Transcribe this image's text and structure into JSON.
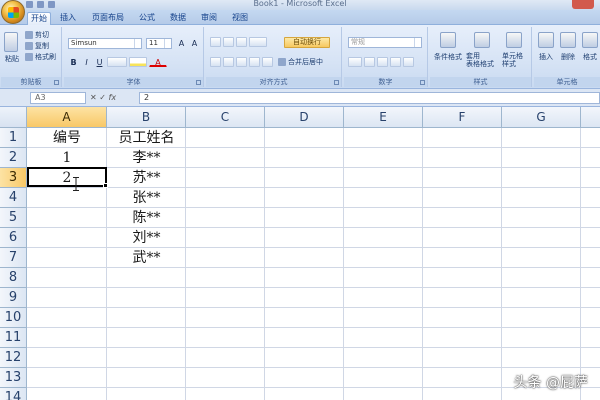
{
  "window": {
    "title": "Book1 - Microsoft Excel"
  },
  "tabs": [
    "开始",
    "插入",
    "页面布局",
    "公式",
    "数据",
    "审阅",
    "视图"
  ],
  "ribbon": {
    "clipboard": {
      "paste": "粘贴",
      "cut": "剪切",
      "copy": "复制",
      "format_painter": "格式刷",
      "label": "剪贴板"
    },
    "font": {
      "name": "Simsun",
      "size": "11",
      "label": "字体"
    },
    "alignment": {
      "wrap_text": "自动换行",
      "merge_center": "合并后居中",
      "label": "对齐方式"
    },
    "number": {
      "format": "常规",
      "label": "数字"
    },
    "styles": {
      "conditional": "条件格式",
      "table": "套用\n表格格式",
      "cell_styles": "单元格\n样式",
      "label": "样式"
    },
    "cells": {
      "insert": "插入",
      "delete": "删除",
      "format": "格式",
      "label": "单元格"
    }
  },
  "formula_bar": {
    "name_box": "A3",
    "value": "2",
    "fx": "fx"
  },
  "columns": [
    "A",
    "B",
    "C",
    "D",
    "E",
    "F",
    "G"
  ],
  "rows": [
    "1",
    "2",
    "3",
    "4",
    "5",
    "6",
    "7",
    "8",
    "9",
    "10",
    "11",
    "12",
    "13",
    "14"
  ],
  "cells": {
    "A1": "编号",
    "B1": "员工姓名",
    "A2": "1",
    "B2": "李**",
    "A3": "2",
    "B3": "苏**",
    "B4": "张**",
    "B5": "陈**",
    "B6": "刘**",
    "B7": "武**"
  },
  "selection": {
    "cell": "A3",
    "column": "A",
    "row": "3"
  },
  "watermark": "头条 @屁萨"
}
